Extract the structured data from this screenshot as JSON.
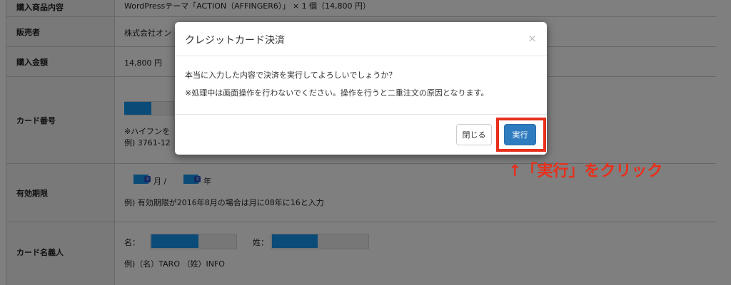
{
  "form": {
    "rows": [
      {
        "label": "購入商品内容",
        "value": "WordPressテーマ「ACTION（AFFINGER6）」 × 1 個（14,800 円）"
      },
      {
        "label": "販売者",
        "value": "株式会社オン"
      },
      {
        "label": "購入金額",
        "value": "14,800 円"
      },
      {
        "label": "カード番号",
        "note1": "※ハイフンを",
        "note2": "例) 3761-12"
      },
      {
        "label": "有効期限",
        "month_suffix": "月 /",
        "year_suffix": "年",
        "example": "例) 有効期限が2016年8月の場合は月に08年に16と入力"
      },
      {
        "label": "カード名義人",
        "first_label": "名：",
        "last_label": "姓：",
        "example": "例)（名）TARO （姓）INFO"
      }
    ]
  },
  "modal": {
    "title": "クレジットカード決済",
    "close_glyph": "×",
    "message": "本当に入力した内容で決済を実行してよろしいでしょうか？",
    "warning": "※処理中は画面操作を行わないでください。操作を行うと二重注文の原因となります。",
    "close_button": "閉じる",
    "run_button": "実行"
  },
  "annotation": {
    "text": "↑「実行」をクリック",
    "color": "#e8301c"
  },
  "colors": {
    "highlight_blue": "#1496f0",
    "primary_button": "#2f7bbf"
  }
}
